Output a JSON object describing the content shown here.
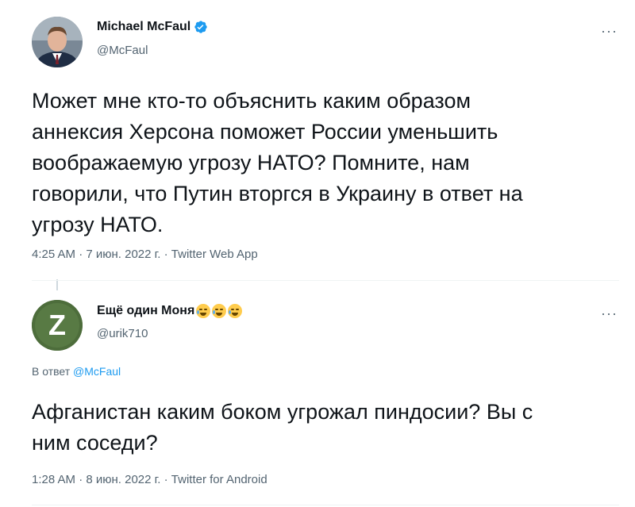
{
  "tweet1": {
    "name": "Michael McFaul",
    "handle": "@McFaul",
    "verified": true,
    "more_label": "···",
    "text_lines": [
      "Может мне кто-то объяснить каким образом",
      "аннексия Херсона поможет России уменьшить",
      "воображаемую угрозу НАТО? Помните, нам",
      "говорили, что Путин вторгся в Украину в ответ на",
      "угрозу НАТО."
    ],
    "meta": "4:25 AM · 7 июн. 2022 г. · Twitter Web App"
  },
  "tweet2": {
    "name": "Ещё один Моня",
    "handle": "@urik710",
    "avatar_letter": "Z",
    "emoji_count": 3,
    "more_label": "···",
    "reply_prefix": "В ответ",
    "reply_handle": "@McFaul",
    "text_lines": [
      "Афганистан каким боком угрожал пиндосии? Вы с",
      "ним соседи?"
    ],
    "meta": "1:28 AM · 8 июн. 2022 г. · Twitter for Android"
  },
  "colors": {
    "accent": "#1d9bf0",
    "secondary_text": "#536471",
    "primary_text": "#0f1419",
    "avatar2_bg": "#4a6a3a"
  }
}
